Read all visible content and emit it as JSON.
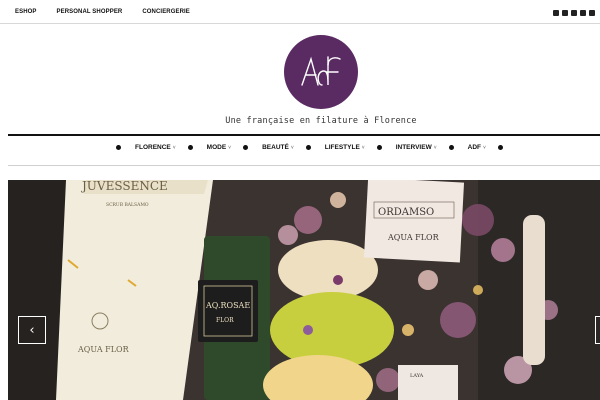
{
  "top_nav": {
    "items": [
      "ESHOP",
      "PERSONAL SHOPPER",
      "CONCIERGERIE"
    ]
  },
  "social": {
    "icons": [
      "facebook-icon",
      "twitter-icon",
      "instagram-icon",
      "pinterest-icon",
      "linkedin-icon"
    ]
  },
  "logo": {
    "text": "AdF",
    "color": "#5a2a63"
  },
  "tagline": "Une française en filature à Florence",
  "main_nav": {
    "items": [
      "FLORENCE",
      "MODE",
      "BEAUTÉ",
      "LIFESTYLE",
      "INTERVIEW",
      "ADF"
    ],
    "chevron": "˅"
  },
  "slider": {
    "prev_label": "‹",
    "next_label": "›",
    "tube_text": "JUVESSENCE",
    "tube_subtext": "SCRUB BALSAMO",
    "tube_brand": "AQUA FLOR",
    "bottle_label": "AQ.ROSAE",
    "bottle_brand": "FLOR",
    "box_label": "ORDAMSO",
    "box_brand": "AQUA FLOR",
    "small_label": "LAYA"
  }
}
